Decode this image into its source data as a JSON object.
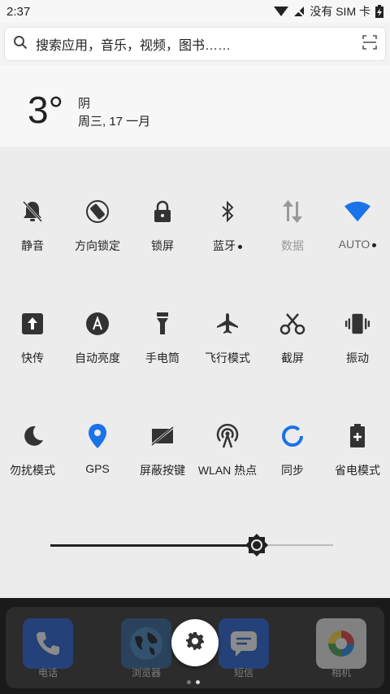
{
  "status": {
    "time": "2:37",
    "sim": "没有 SIM 卡"
  },
  "search": {
    "placeholder": "搜索应用，音乐，视频，图书……"
  },
  "weather": {
    "temp": "3°",
    "condition": "阴",
    "date": "周三, 17 一月"
  },
  "tiles": [
    {
      "label": "静音",
      "icon": "bell-off-icon"
    },
    {
      "label": "方向锁定",
      "icon": "rotation-lock-icon"
    },
    {
      "label": "锁屏",
      "icon": "lock-icon"
    },
    {
      "label": "蓝牙",
      "icon": "bluetooth-icon"
    },
    {
      "label": "数据",
      "icon": "mobile-data-icon"
    },
    {
      "label": "AUTO",
      "icon": "wifi-icon"
    },
    {
      "label": "快传",
      "icon": "quick-send-icon"
    },
    {
      "label": "自动亮度",
      "icon": "auto-brightness-icon"
    },
    {
      "label": "手电筒",
      "icon": "flashlight-icon"
    },
    {
      "label": "飞行模式",
      "icon": "airplane-icon"
    },
    {
      "label": "截屏",
      "icon": "scissors-icon"
    },
    {
      "label": "振动",
      "icon": "vibrate-icon"
    },
    {
      "label": "勿扰模式",
      "icon": "moon-icon"
    },
    {
      "label": "GPS",
      "icon": "location-pin-icon"
    },
    {
      "label": "屏蔽按键",
      "icon": "block-keys-icon"
    },
    {
      "label": "WLAN 热点",
      "icon": "hotspot-icon"
    },
    {
      "label": "同步",
      "icon": "sync-icon"
    },
    {
      "label": "省电模式",
      "icon": "battery-saver-icon"
    }
  ],
  "brightness": {
    "level": 0.73
  },
  "dock": {
    "apps": [
      {
        "label": "电话",
        "icon": "phone-icon"
      },
      {
        "label": "浏览器",
        "icon": "globe-icon"
      },
      {
        "label": "短信",
        "icon": "message-icon"
      },
      {
        "label": "相机",
        "icon": "camera-icon"
      }
    ]
  },
  "colors": {
    "accent": "#1a73e8",
    "text": "#222222",
    "dim": "#999999"
  }
}
